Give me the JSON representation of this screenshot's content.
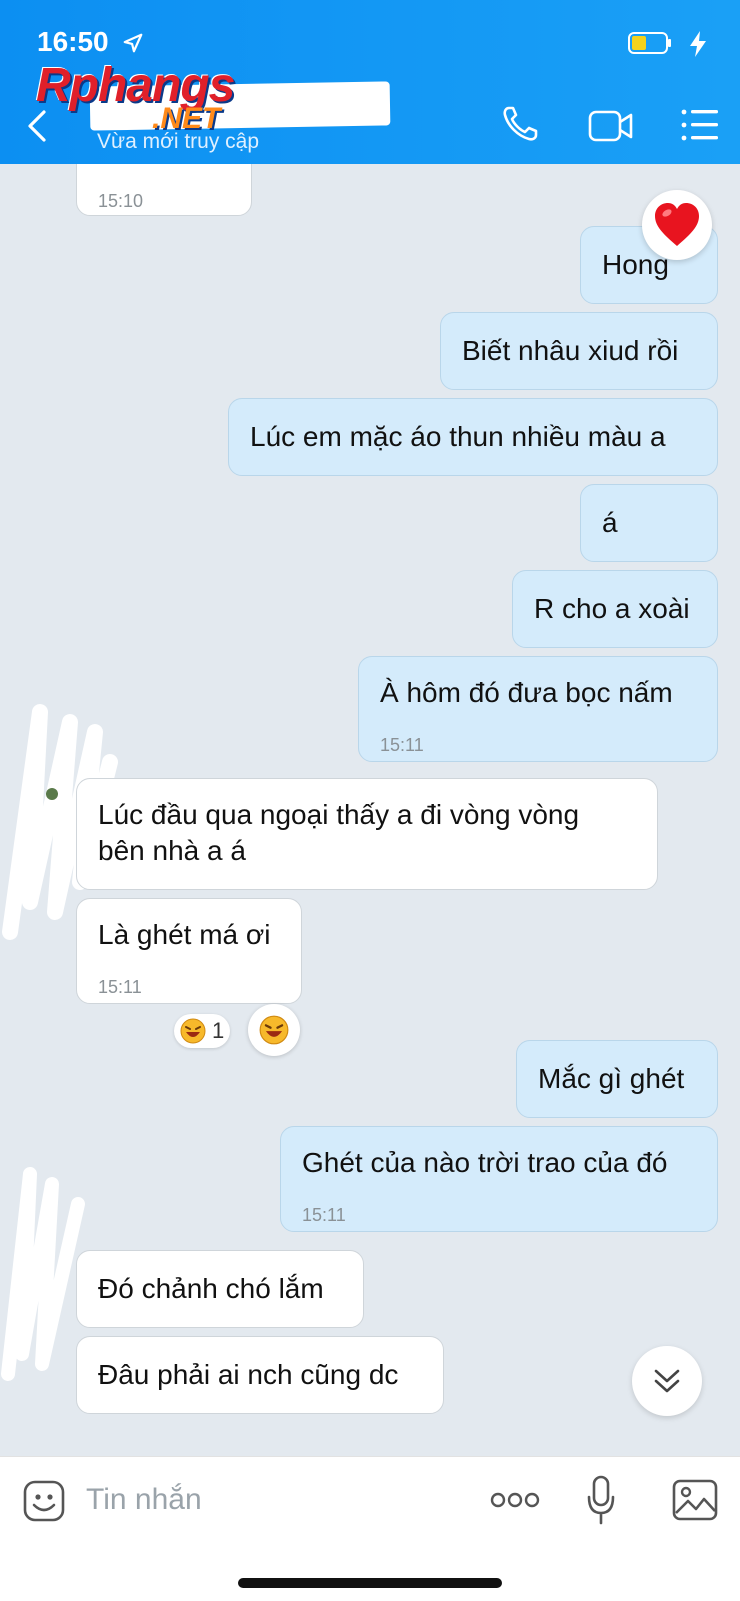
{
  "status_bar": {
    "time": "16:50"
  },
  "header": {
    "watermark_main": "Rphangs",
    "watermark_net": ".NET",
    "subtitle": "Vừa mới truy cập",
    "accent_color": "#1aa0f6"
  },
  "messages": [
    {
      "direction": "in",
      "text": "",
      "time": "15:10"
    },
    {
      "direction": "out",
      "text": "Hong",
      "reaction": "heart-icon"
    },
    {
      "direction": "out",
      "text": "Biết nhâu xiud rồi"
    },
    {
      "direction": "out",
      "text": "Lúc em mặc áo thun nhiều màu a"
    },
    {
      "direction": "out",
      "text": "á"
    },
    {
      "direction": "out",
      "text": "R cho a xoài"
    },
    {
      "direction": "out",
      "text": "À hôm đó đưa bọc nấm",
      "time": "15:11"
    },
    {
      "direction": "in",
      "text_line1": "Lúc đầu qua ngoại thấy  a đi vòng vòng",
      "text_line2": "bên nhà a  á"
    },
    {
      "direction": "in",
      "text": "Là ghét má ơi",
      "time": "15:11",
      "reaction_count": "1"
    },
    {
      "direction": "out",
      "text": "Mắc gì ghét"
    },
    {
      "direction": "out",
      "text": "Ghét của nào trời trao của đó",
      "time": "15:11"
    },
    {
      "direction": "in",
      "text": "Đó chảnh chó lắm"
    },
    {
      "direction": "in",
      "text": "Đâu phải ai nch cũng dc"
    }
  ],
  "composer": {
    "placeholder": "Tin nhắn"
  },
  "colors": {
    "outgoing_bubble": "#d4ebfb",
    "incoming_bubble": "#ffffff",
    "chat_bg": "#e3e9ef"
  }
}
